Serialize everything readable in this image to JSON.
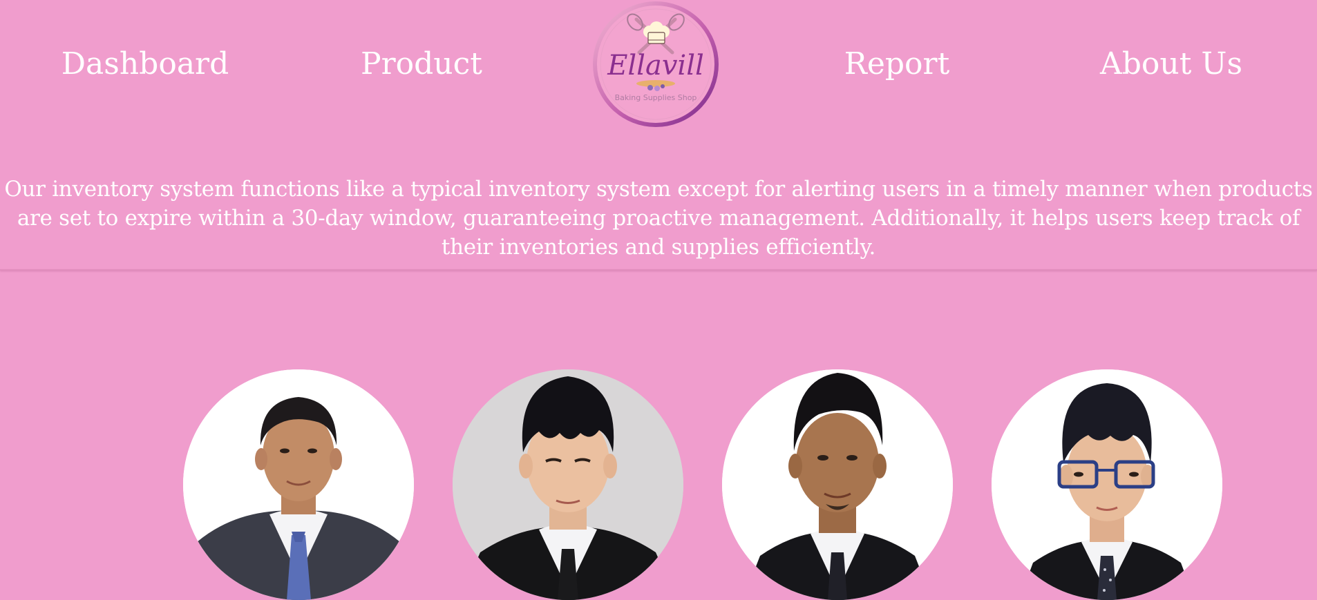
{
  "nav": {
    "dashboard": "Dashboard",
    "product": "Product",
    "report": "Report",
    "about": "About Us"
  },
  "logo": {
    "brand": "Ellavill",
    "tagline": "Baking Supplies Shop",
    "icon": "chef-hat-with-whisks-icon"
  },
  "description": "Our inventory system functions like a typical inventory system except for alerting users in a timely manner when products are set to expire within a 30-day window, guaranteeing proactive management. Additionally, it helps users keep track of their inventories and supplies efficiently.",
  "colors": {
    "background": "#f09dcd",
    "text": "#ffffff",
    "logo_purple": "#8a2f8f"
  },
  "team": [
    {
      "photo": "team-member-photo"
    },
    {
      "photo": "team-member-photo"
    },
    {
      "photo": "team-member-photo"
    },
    {
      "photo": "team-member-photo"
    }
  ]
}
